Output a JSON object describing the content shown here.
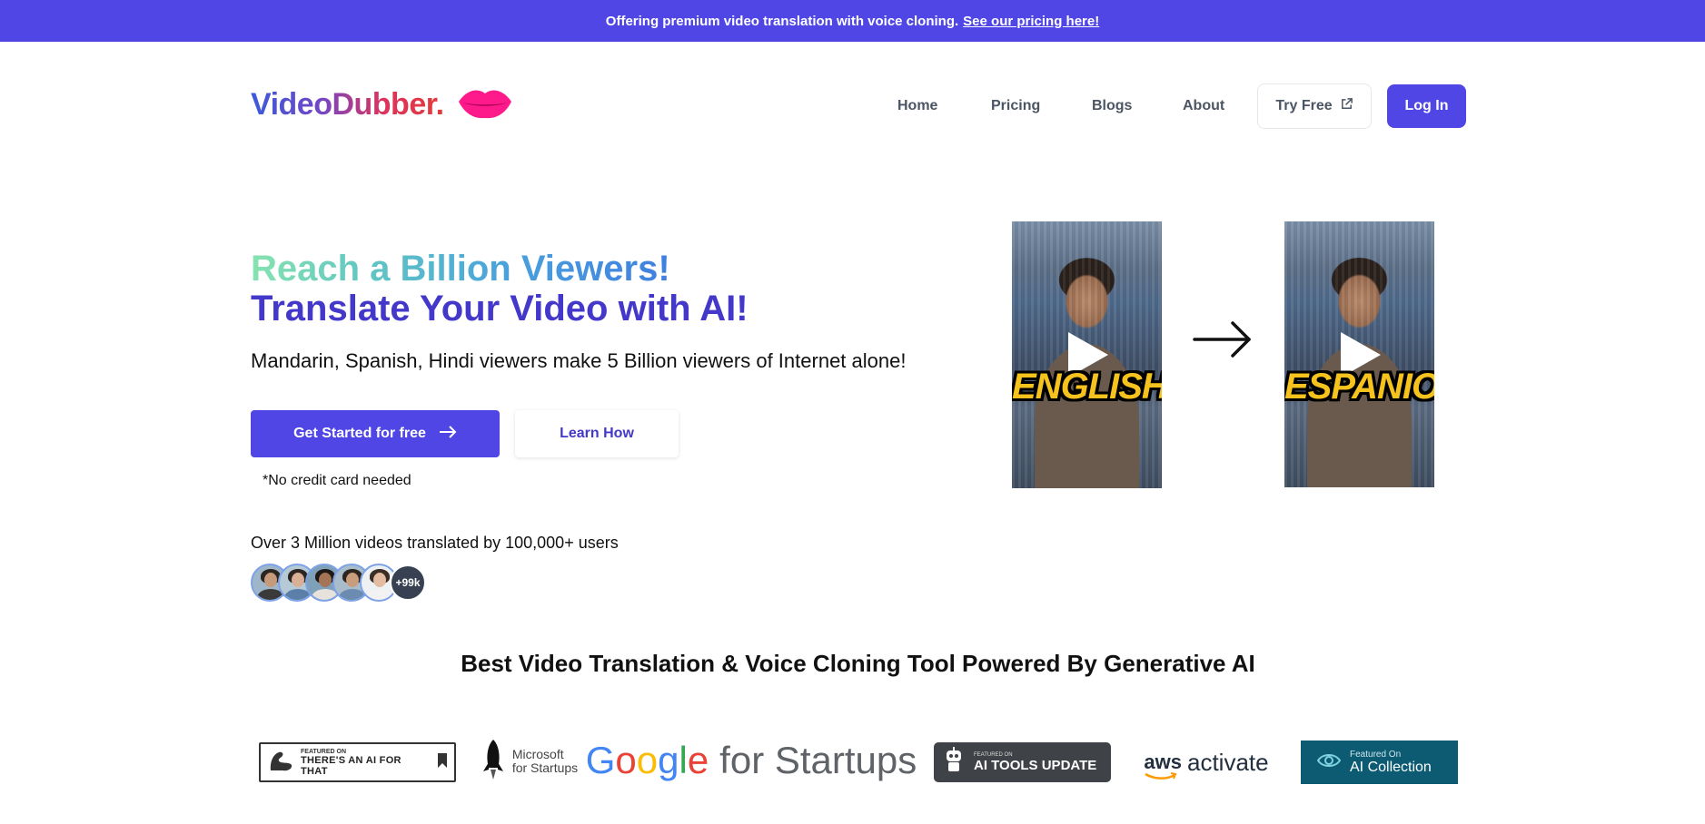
{
  "banner": {
    "text": "Offering premium video translation with voice cloning.",
    "link": "See our pricing here!"
  },
  "brand": {
    "name": "VideoDubber.",
    "logo_icon": "lips-icon"
  },
  "nav": {
    "links": [
      "Home",
      "Pricing",
      "Blogs",
      "About"
    ],
    "try_free": "Try Free",
    "login": "Log In"
  },
  "hero": {
    "line1": "Reach a Billion Viewers!",
    "line2": "Translate Your Video with AI!",
    "subtitle": "Mandarin, Spanish, Hindi viewers make 5 Billion viewers of Internet alone!",
    "cta_primary": "Get Started for free",
    "cta_secondary": "Learn How",
    "note": "*No credit card needed"
  },
  "videos": {
    "source_label": "ENGLISH",
    "target_label": "ESPANIOL"
  },
  "social_proof": {
    "stat": "Over 3 Million videos translated by 100,000+ users",
    "more_count": "+99k"
  },
  "tagline": "Best Video Translation & Voice Cloning Tool Powered By Generative AI",
  "logos": {
    "aithat_small": "FEATURED ON",
    "aithat_big": "THERE'S AN AI FOR THAT",
    "ms_line1": "Microsoft",
    "ms_line2": "for Startups",
    "google_word": "Google",
    "google_rest": "for Startups",
    "aitools_small": "FEATURED ON",
    "aitools_big": "AI TOOLS UPDATE",
    "aws_word": "aws",
    "aws_rest": "activate",
    "aicoll_small": "Featured On",
    "aicoll_big": "AI Collection"
  },
  "colors": {
    "primary": "#4f46e5",
    "heading_blue": "#4338ca"
  }
}
